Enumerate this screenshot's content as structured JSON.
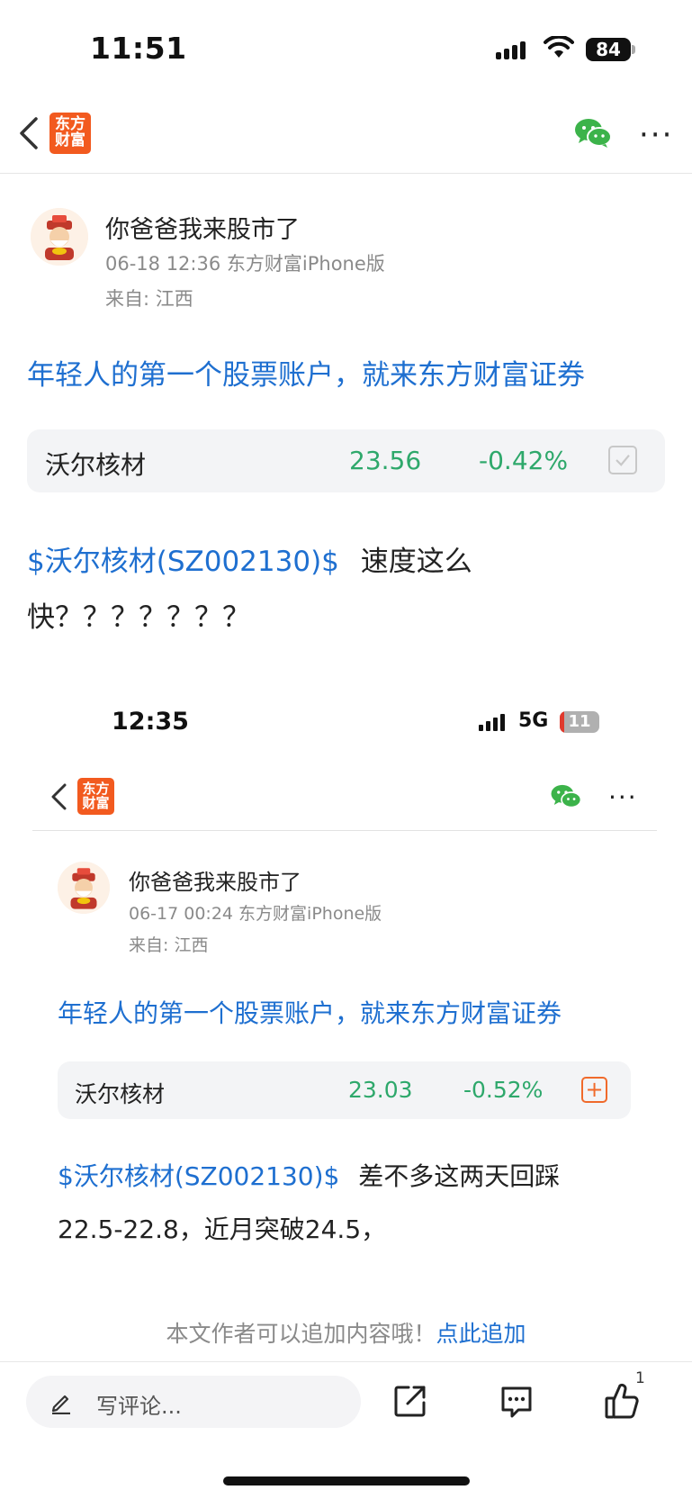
{
  "status_bar": {
    "time": "11:51",
    "battery": "84"
  },
  "nav": {
    "logo_line1": "东方",
    "logo_line2": "财富",
    "wechat_icon": "wechat-icon",
    "more": "···"
  },
  "post": {
    "author": "你爸爸我来股市了",
    "meta": "06-18 12:36 东方财富iPhone版",
    "location": "来自: 江西",
    "promo": "年轻人的第一个股票账户，就来东方财富证券",
    "stock_card": {
      "name": "沃尔核材",
      "price": "23.56",
      "change": "-0.42%"
    },
    "body_link": "$沃尔核材(SZ002130)$",
    "body_text_a": "速度这么",
    "body_text_b": "快？？？？？？？"
  },
  "embedded": {
    "status_time": "12:35",
    "network": "5G",
    "battery": "11",
    "battery_level": 0.11,
    "logo_line1": "东方",
    "logo_line2": "财富",
    "more": "···",
    "author": "你爸爸我来股市了",
    "meta": "06-17 00:24 东方财富iPhone版",
    "location": "来自: 江西",
    "promo": "年轻人的第一个股票账户，就来东方财富证券",
    "stock_card": {
      "name": "沃尔核材",
      "price": "23.03",
      "change": "-0.52%",
      "action": "+"
    },
    "body_link": "$沃尔核材(SZ002130)$",
    "body_text_a": "差不多这两天回踩",
    "body_text_b": "22.5-22.8，近月突破24.5，"
  },
  "footer": {
    "notice_text": "本文作者可以追加内容哦！",
    "notice_link": "点此追加"
  },
  "bottom_bar": {
    "comment_placeholder": "写评论...",
    "like_count": "1"
  },
  "colors": {
    "link_blue": "#1e6fd0",
    "price_green": "#2ea86b",
    "brand_orange": "#f25a1f",
    "wechat_green": "#3cb34a"
  }
}
